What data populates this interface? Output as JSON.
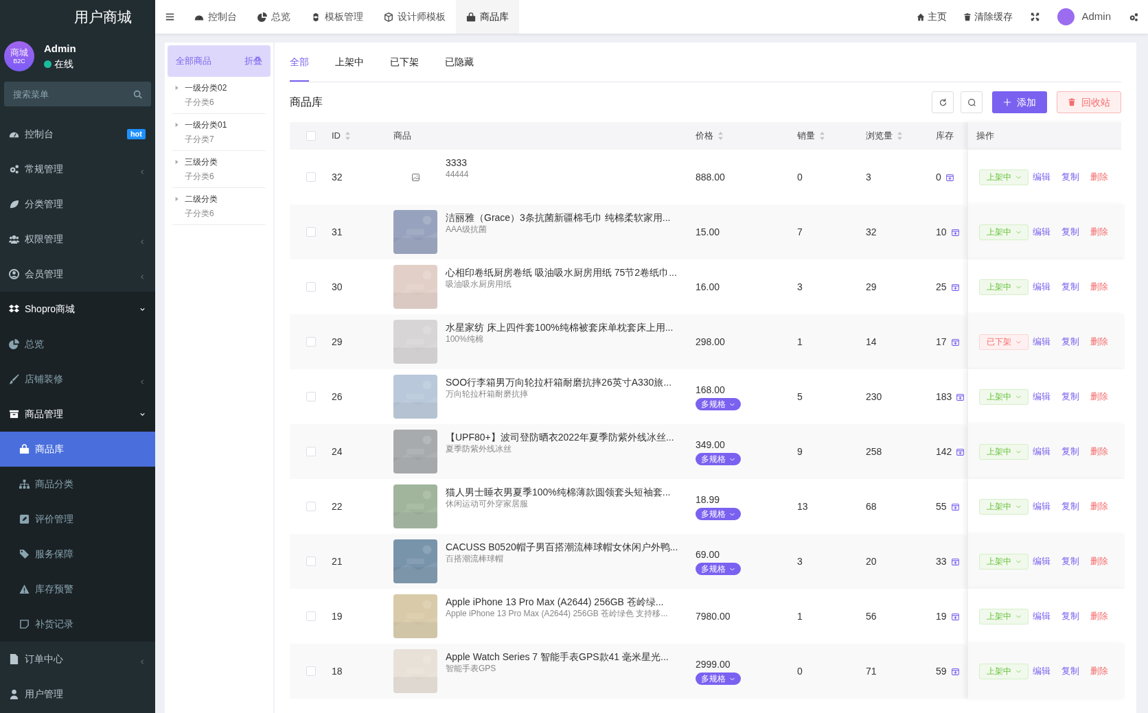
{
  "sidebar": {
    "title": "用户商城",
    "user": {
      "avatar_text": "商城",
      "avatar_sub": "B2C",
      "name": "Admin",
      "status": "在线"
    },
    "search": {
      "placeholder": "搜索菜单"
    },
    "menu": [
      {
        "label": "控制台",
        "badge": "hot",
        "selected": false
      },
      {
        "label": "常规管理",
        "expanded": false,
        "selected": false
      },
      {
        "label": "分类管理",
        "selected": false
      },
      {
        "label": "权限管理",
        "expanded": false,
        "selected": false
      },
      {
        "label": "会员管理",
        "expanded": false,
        "selected": false
      },
      {
        "label": "Shopro商城",
        "expanded": true,
        "selected": false,
        "children": [
          {
            "label": "总览",
            "selected": false
          },
          {
            "label": "店铺装修",
            "expanded": false,
            "selected": false
          },
          {
            "label": "商品管理",
            "expanded": true,
            "selected": false,
            "children": [
              {
                "label": "商品库",
                "selected": true
              },
              {
                "label": "商品分类",
                "selected": false
              },
              {
                "label": "评价管理",
                "selected": false
              },
              {
                "label": "服务保障",
                "selected": false
              },
              {
                "label": "库存预警",
                "selected": false
              },
              {
                "label": "补货记录",
                "selected": false
              }
            ]
          }
        ]
      },
      {
        "label": "订单中心",
        "expanded": false,
        "selected": false
      },
      {
        "label": "用户管理",
        "selected": false
      }
    ]
  },
  "topbar": {
    "tabs": [
      {
        "label": "控制台",
        "selected": false
      },
      {
        "label": "总览",
        "selected": false
      },
      {
        "label": "模板管理",
        "selected": false
      },
      {
        "label": "设计师模板",
        "selected": false
      },
      {
        "label": "商品库",
        "selected": true
      }
    ],
    "links": [
      {
        "label": "主页"
      },
      {
        "label": "清除缓存"
      }
    ],
    "user": "Admin"
  },
  "categories": {
    "header": {
      "label": "全部商品",
      "selected": true,
      "action": "折叠"
    },
    "items": [
      {
        "label": "一级分类02",
        "sub": "子分类6",
        "expanded": false
      },
      {
        "label": "一级分类01",
        "sub": "子分类7",
        "expanded": false
      },
      {
        "label": "三级分类",
        "sub": "子分类6",
        "expanded": false
      },
      {
        "label": "二级分类",
        "sub": "子分类6",
        "expanded": false
      }
    ]
  },
  "tabs": [
    {
      "label": "全部",
      "selected": true
    },
    {
      "label": "上架中",
      "selected": false
    },
    {
      "label": "已下架",
      "selected": false
    },
    {
      "label": "已隐藏",
      "selected": false
    }
  ],
  "title": "商品库",
  "buttons": {
    "add": "添加",
    "recycle": "回收站"
  },
  "table": {
    "select_all_checked": false,
    "columns": [
      {
        "label": "ID",
        "sortable": true
      },
      {
        "label": "商品",
        "sortable": false
      },
      {
        "label": "价格",
        "sortable": true
      },
      {
        "label": "销量",
        "sortable": true
      },
      {
        "label": "浏览量",
        "sortable": true
      },
      {
        "label": "库存",
        "sortable": false
      },
      {
        "label": "操作",
        "sortable": false
      }
    ],
    "rows": [
      {
        "checked": false,
        "id": "32",
        "image": {
          "kind": "empty"
        },
        "name": "3333",
        "subtitle": "44444",
        "price": "888.00",
        "sales": "0",
        "views": "3",
        "stock": "0",
        "status": {
          "label": "上架中",
          "kind": "on"
        },
        "actions": [
          "编辑",
          "复制",
          "删除"
        ]
      },
      {
        "checked": false,
        "id": "31",
        "image": {
          "kind": "picture"
        },
        "name": "洁丽雅（Grace）3条抗菌新疆棉毛巾 纯棉柔软家用...",
        "subtitle": "AAA级抗菌",
        "price": "15.00",
        "sales": "7",
        "views": "32",
        "stock": "10",
        "status": {
          "label": "上架中",
          "kind": "on"
        },
        "actions": [
          "编辑",
          "复制",
          "删除"
        ]
      },
      {
        "checked": false,
        "id": "30",
        "image": {
          "kind": "picture"
        },
        "name": "心相印卷纸厨房卷纸 吸油吸水厨房用纸 75节2卷纸巾...",
        "subtitle": "吸油吸水厨房用纸",
        "price": "16.00",
        "sales": "3",
        "views": "29",
        "stock": "25",
        "status": {
          "label": "上架中",
          "kind": "on"
        },
        "actions": [
          "编辑",
          "复制",
          "删除"
        ]
      },
      {
        "checked": false,
        "id": "29",
        "image": {
          "kind": "picture"
        },
        "name": "水星家纺 床上四件套100%纯棉被套床单枕套床上用...",
        "subtitle": "100%纯棉",
        "price": "298.00",
        "sales": "1",
        "views": "14",
        "stock": "17",
        "status": {
          "label": "已下架",
          "kind": "off"
        },
        "actions": [
          "编辑",
          "复制",
          "删除"
        ]
      },
      {
        "checked": false,
        "id": "26",
        "image": {
          "kind": "picture"
        },
        "name": "SOO行李箱男万向轮拉杆箱耐磨抗摔26英寸A330旅...",
        "subtitle": "万向轮拉杆箱耐磨抗摔",
        "price": "168.00",
        "spec": "多规格",
        "sales": "5",
        "views": "230",
        "stock": "183",
        "status": {
          "label": "上架中",
          "kind": "on"
        },
        "actions": [
          "编辑",
          "复制",
          "删除"
        ]
      },
      {
        "checked": false,
        "id": "24",
        "image": {
          "kind": "picture"
        },
        "name": "【UPF80+】波司登防晒衣2022年夏季防紫外线冰丝...",
        "subtitle": "夏季防紫外线冰丝",
        "price": "349.00",
        "spec": "多规格",
        "sales": "9",
        "views": "258",
        "stock": "142",
        "status": {
          "label": "上架中",
          "kind": "on"
        },
        "actions": [
          "编辑",
          "复制",
          "删除"
        ]
      },
      {
        "checked": false,
        "id": "22",
        "image": {
          "kind": "picture"
        },
        "name": "猫人男士睡衣男夏季100%纯棉薄款圆领套头短袖套...",
        "subtitle": "休闲运动可外穿家居服",
        "price": "18.99",
        "spec": "多规格",
        "sales": "13",
        "views": "68",
        "stock": "55",
        "status": {
          "label": "上架中",
          "kind": "on"
        },
        "actions": [
          "编辑",
          "复制",
          "删除"
        ]
      },
      {
        "checked": false,
        "id": "21",
        "image": {
          "kind": "picture"
        },
        "name": "CACUSS B0520帽子男百搭潮流棒球帽女休闲户外鸭...",
        "subtitle": "百搭潮流棒球帽",
        "price": "69.00",
        "spec": "多规格",
        "sales": "3",
        "views": "20",
        "stock": "33",
        "status": {
          "label": "上架中",
          "kind": "on"
        },
        "actions": [
          "编辑",
          "复制",
          "删除"
        ]
      },
      {
        "checked": false,
        "id": "19",
        "image": {
          "kind": "picture"
        },
        "name": "Apple iPhone 13 Pro Max (A2644) 256GB 苍岭绿...",
        "subtitle": "Apple iPhone 13 Pro Max (A2644) 256GB 苍岭绿色 支持移...",
        "price": "7980.00",
        "sales": "1",
        "views": "56",
        "stock": "19",
        "status": {
          "label": "上架中",
          "kind": "on"
        },
        "actions": [
          "编辑",
          "复制",
          "删除"
        ]
      },
      {
        "checked": false,
        "id": "18",
        "image": {
          "kind": "picture"
        },
        "name": "Apple Watch Series 7 智能手表GPS款41 毫米星光...",
        "subtitle": "智能手表GPS",
        "price": "2999.00",
        "spec": "多规格",
        "sales": "0",
        "views": "71",
        "stock": "59",
        "status": {
          "label": "上架中",
          "kind": "on"
        },
        "actions": [
          "编辑",
          "复制",
          "删除"
        ]
      }
    ]
  }
}
